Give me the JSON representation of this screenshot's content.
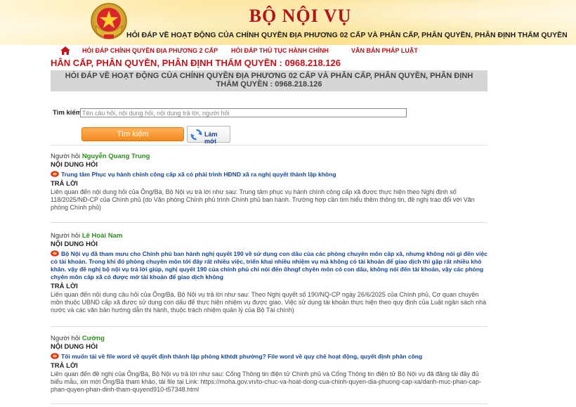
{
  "header": {
    "agency_name": "BỘ NỘI VỤ",
    "subtitle": "HỎI ĐÁP VỀ HOẠT ĐỘNG CỦA CHÍNH QUYỀN ĐỊA PHƯƠNG 02 CẤP VÀ PHÂN CẤP, PHÂN QUYỀN, PHÂN ĐỊNH THẨM QUYỀN"
  },
  "nav": {
    "items": [
      {
        "label": "HỎI ĐÁP CHÍNH QUYỀN ĐỊA PHƯƠNG 2 CẤP"
      },
      {
        "label": "HỎI ĐÁP THỦ TỤC HÀNH CHÍNH"
      },
      {
        "label": "VĂN BẢN PHÁP LUẬT"
      }
    ]
  },
  "marquee_text": "HÂN CẤP, PHÂN QUYỀN, PHÂN ĐỊNH THẨM QUYỀN : 0968.218.126",
  "main": {
    "title": "HỎI ĐÁP VỀ HOẠT ĐỘNG CỦA CHÍNH QUYỀN ĐỊA PHƯƠNG 02 CẤP VÀ PHÂN CẤP, PHÂN QUYỀN, PHÂN ĐỊNH THẨM QUYỀN : 0968.218.126"
  },
  "search": {
    "label": "Tìm kiếm:",
    "placeholder": "Tên câu hỏi, nội dung hỏi, nội dung trả lời, người hỏi",
    "value": "",
    "button_label": "Tìm kiếm",
    "refresh_label": "Làm mới"
  },
  "labels": {
    "asker_prefix": "Người hỏi",
    "question_heading": "NỘI DUNG HỎI",
    "answer_heading": "TRẢ LỜI"
  },
  "qa_items": [
    {
      "asker": "Nguyễn Quang Trung",
      "question": "Trung tâm Phục vụ hành chính công cấp xã có phải trình HĐND xã ra nghị quyết thành lập không",
      "answer": "Liên quan đến nội dung hỏi của Ông/Bà, Bộ Nội vụ trả lời như sau: Trung tâm phục vụ hành chính công cấp xã được thực hiện theo Nghị định số 118/2025/NĐ-CP của Chính phủ (do Văn phòng Chính phủ trình Chính phủ ban hành. Trường hợp cần tìm hiểu thêm thông tin, đề nghị trao đổi với Văn phòng Chính phủ)"
    },
    {
      "asker": "Lê Hoài Nam",
      "question": "Bộ Nội vụ đã tham mưu cho Chính phủ ban hành nghị quyết 190 về sử dụng con dấu của các phòng chuyên môn cấp xã, nhưng không nói gì đến việc có tài khoản. Trong khi đó phòng chuyên môn tới đây rất nhiều việc, triển khai nhiều nhiệm vụ mà không có tài khoản để giao dịch thì gặp rất nhiều khó khăn. vậy đề nghị bộ nội vụ trả lời giúp, nghị quyết 190 của chính phủ chỉ nói đến ôhngf chyên môn có con dấu, không nói đến tài khoản, vậy các phòng chyên môn cấp xã có được mở tài khoản để giao dịch không",
      "answer": "Liên quan đến nội dung câu hỏi của Ông/Bà, Bộ Nội vụ trả lời như sau: Theo Nghị quyết số 190/NQ-CP ngày 26/6/2025 của Chính phủ, Cơ quan chuyên môn thuộc UBND cấp xã được sử dụng con dấu để thực hiện nhiệm vụ được giao. Việc sử dụng tài khoản thực hiện theo quy định của Luật ngân sách nhà nước và các văn bản hướng dẫn thi hành, thuộc trách nhiệm quản lý của Bộ Tài chính)"
    },
    {
      "asker": "Cường",
      "question": "Tôi muốn tải về file word về quyết định thành lập phòng kthtdt phường? File word về quy chế hoạt động, quyết định phân công",
      "answer": "Liên quan đến đề nghị của Ông/Bà, Bộ Nội vụ trả lời như sau: Cổng Thông tin điện tử Chính phủ và Cổng Thông tin điện tử Bộ Nội vụ đã đăng tải đầy đủ biểu mẫu, xin mời Ông/Bà tham khảo, tải file tại Link: https://moha.gov.vn/to-chuc-va-hoat-dong-cua-chinh-quyen-dia-phuong-cap-xa/danh-muc-phan-cap-phan-quyen-phan-dinh-tham-quyend910-t57348.html"
    }
  ],
  "colors": {
    "brand_red": "#b3131b",
    "asker_green": "#2e8b1f",
    "question_blue": "#17468f",
    "button_orange": "#f28a1f"
  }
}
